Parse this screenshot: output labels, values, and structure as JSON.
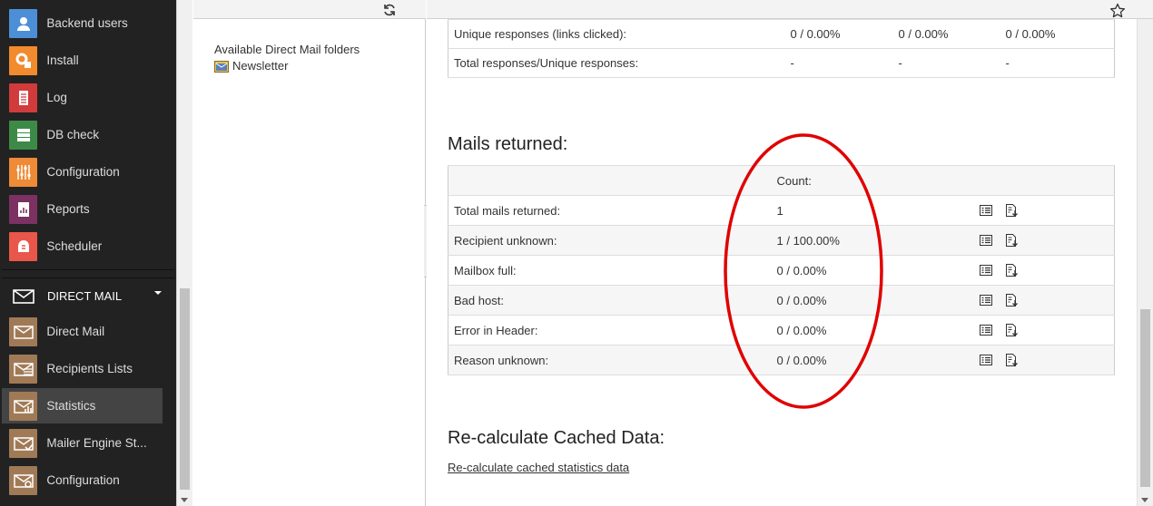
{
  "sidebar": {
    "items": [
      {
        "label": "Backend users",
        "icon": "user-icon",
        "color": "#4c8fd6"
      },
      {
        "label": "Install",
        "icon": "install-gear-icon",
        "color": "#f28a2e"
      },
      {
        "label": "Log",
        "icon": "log-icon",
        "color": "#d13b3b"
      },
      {
        "label": "DB check",
        "icon": "db-check-icon",
        "color": "#3d8a48"
      },
      {
        "label": "Configuration",
        "icon": "configuration-sliders-icon",
        "color": "#ef8a36"
      },
      {
        "label": "Reports",
        "icon": "reports-icon",
        "color": "#7b3262"
      },
      {
        "label": "Scheduler",
        "icon": "scheduler-icon",
        "color": "#e8574a"
      }
    ],
    "group": {
      "label": "DIRECT MAIL",
      "icon": "mail-envelope-icon"
    },
    "group_items": [
      {
        "label": "Direct Mail",
        "icon": "direct-mail-icon",
        "color": "#a07a56"
      },
      {
        "label": "Recipients Lists",
        "icon": "recipients-lists-icon",
        "color": "#a07a56"
      },
      {
        "label": "Statistics",
        "icon": "statistics-icon",
        "color": "#a07a56",
        "active": true
      },
      {
        "label": "Mailer Engine St...",
        "icon": "mailer-engine-icon",
        "color": "#a07a56"
      },
      {
        "label": "Configuration",
        "icon": "mail-configuration-icon",
        "color": "#a07a56"
      }
    ]
  },
  "nav": {
    "title": "Available Direct Mail folders",
    "folder": "Newsletter"
  },
  "top_table": {
    "rows": [
      {
        "label": "Unique responses (links clicked):",
        "c1": "0 / 0.00%",
        "c2": "0 / 0.00%",
        "c3": "0 / 0.00%"
      },
      {
        "label": "Total responses/Unique responses:",
        "c1": "-",
        "c2": "-",
        "c3": "-"
      }
    ]
  },
  "returned": {
    "heading": "Mails returned:",
    "count_header": "Count:",
    "rows": [
      {
        "label": "Total mails returned:",
        "count": "1"
      },
      {
        "label": "Recipient unknown:",
        "count": "1 / 100.00%"
      },
      {
        "label": "Mailbox full:",
        "count": "0 / 0.00%"
      },
      {
        "label": "Bad host:",
        "count": "0 / 0.00%"
      },
      {
        "label": "Error in Header:",
        "count": "0 / 0.00%"
      },
      {
        "label": "Reason unknown:",
        "count": "0 / 0.00%"
      }
    ]
  },
  "recalc": {
    "heading": "Re-calculate Cached Data:",
    "link": "Re-calculate cached statistics data"
  },
  "annotation_color": "#e00000"
}
